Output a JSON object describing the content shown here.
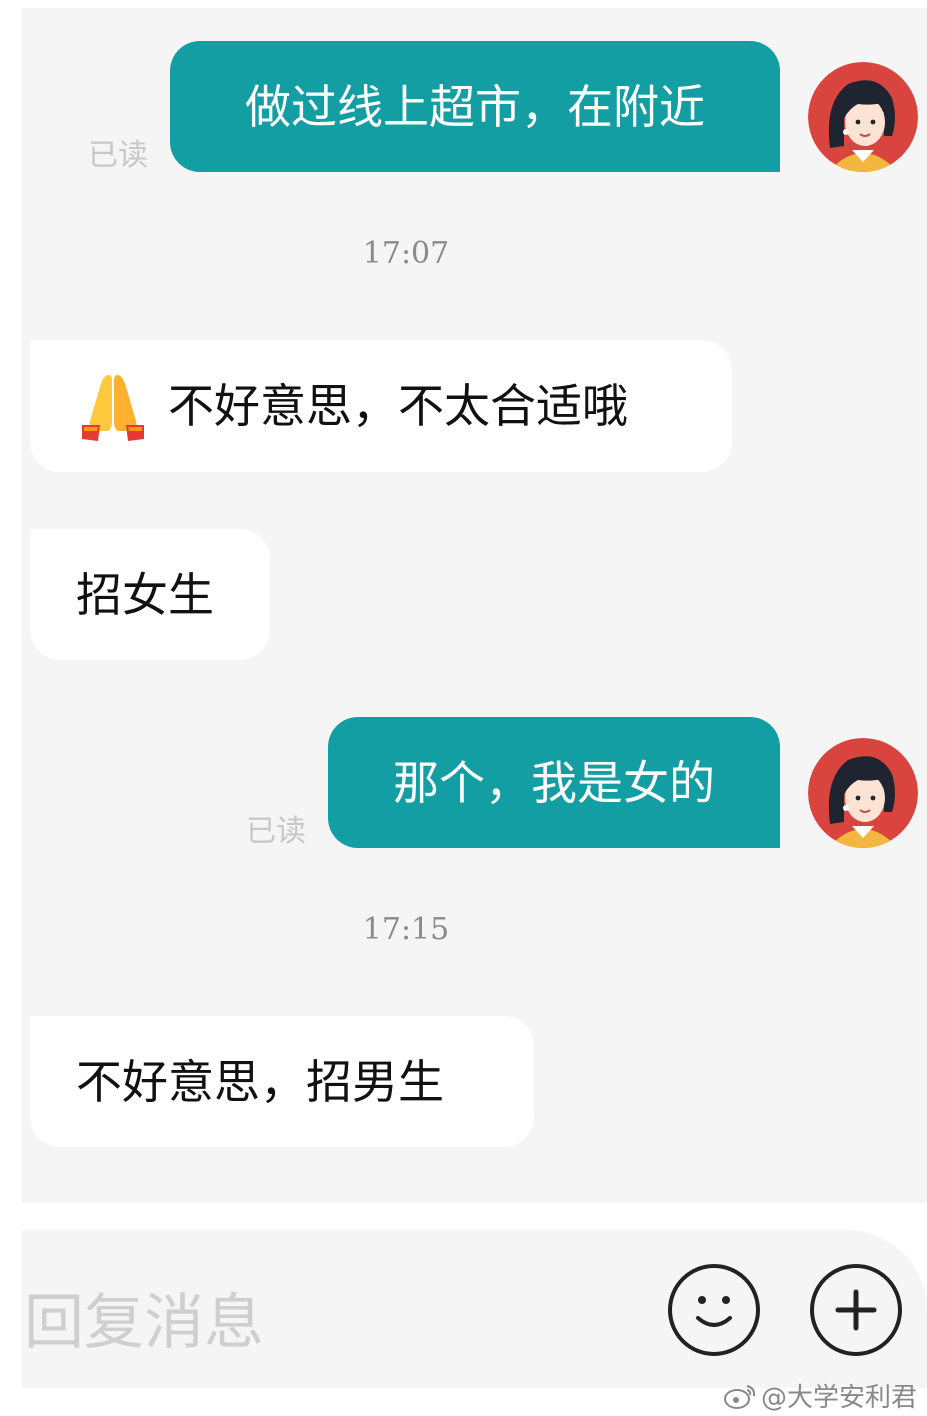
{
  "messages": [
    {
      "direction": "out",
      "text": "做过线上超市，在附近",
      "read_label": "已读"
    },
    {
      "timestamp": "17:07"
    },
    {
      "direction": "in",
      "emoji": "folded-hands-icon",
      "text": "不好意思，不太合适哦"
    },
    {
      "direction": "in",
      "text": "招女生"
    },
    {
      "direction": "out",
      "text": "那个，我是女的",
      "read_label": "已读"
    },
    {
      "timestamp": "17:15"
    },
    {
      "direction": "in",
      "text": "不好意思，招男生"
    }
  ],
  "input": {
    "placeholder": "回复消息",
    "emoji_button_icon": "smiley-icon",
    "plus_button_icon": "plus-icon"
  },
  "watermark": {
    "icon": "weibo-icon",
    "text": "@大学安利君"
  },
  "colors": {
    "outgoing_bubble": "#139ea3",
    "incoming_bubble": "#ffffff",
    "chat_background": "#f5f5f5",
    "avatar_background": "#d9443f"
  }
}
